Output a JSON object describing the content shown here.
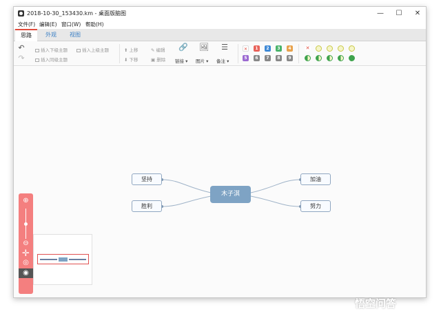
{
  "window": {
    "title": "2018-10-30_153430.km - 桌面版脑图"
  },
  "menu": [
    "文件(F)",
    "编辑(E)",
    "窗口(W)",
    "帮助(H)"
  ],
  "tabs": [
    "思路",
    "外观",
    "视图"
  ],
  "toolbar": {
    "insert_child": "插入下级主题",
    "insert_parent": "插入上级主题",
    "insert_sibling": "插入同级主题",
    "move_up": "上移",
    "move_down": "下移",
    "edit": "编辑",
    "delete": "删除",
    "link": "链接",
    "image": "图片",
    "note": "备注",
    "priorities": [
      "1",
      "2",
      "3",
      "4",
      "5",
      "6",
      "7",
      "8",
      "9"
    ],
    "priority_colors": [
      "#e8625a",
      "#3e89d6",
      "#49b36a",
      "#e8a24c",
      "#9c6ad1",
      "#888888",
      "#888888",
      "#888888",
      "#888888"
    ]
  },
  "mindmap": {
    "root": "木子淇",
    "left": [
      "坚持",
      "胜利"
    ],
    "right": [
      "加油",
      "努力"
    ]
  },
  "watermark": "悟空问答"
}
